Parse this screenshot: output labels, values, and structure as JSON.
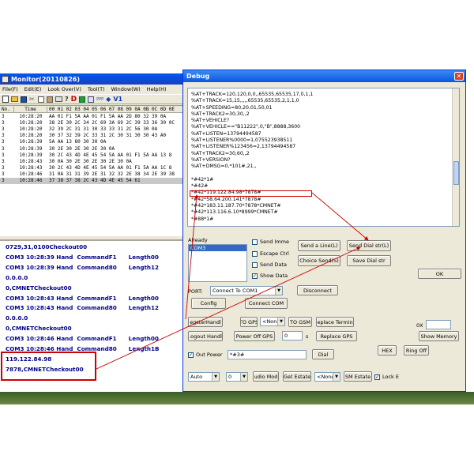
{
  "monitor": {
    "title": "Monitor(20110826)",
    "menu": [
      "File(F)",
      "Edit(E)",
      "Look Over(V)",
      "Tool(T)",
      "Window(W)",
      "Help(H)"
    ],
    "toolbar_v1": "V1",
    "headers": [
      "No.",
      "Time",
      "00 01 02 03 04 05 06 07 08 09 0A 0B 0C 0D 0E"
    ],
    "rows": [
      {
        "no": "3",
        "time": "10:28:20",
        "hex": "AA 01 F1 5A AA 01 F1 5A AA 2D 80 32 39 0A"
      },
      {
        "no": "3",
        "time": "10:28:20",
        "hex": "38 2E 30 2C 34 2C 69 3A 69 2C 39 33 36 30 0C"
      },
      {
        "no": "3",
        "time": "10:28:20",
        "hex": "32 39 2C 31 31 30 33 33 31 2C 56 30 0A"
      },
      {
        "no": "3",
        "time": "10:28:20",
        "hex": "30 37 32 39 2C 33 31 2C 30 31 30 30 43 A0"
      },
      {
        "no": "3",
        "time": "10:28:39",
        "hex": "5A AA 13 80 30 30 0A"
      },
      {
        "no": "3",
        "time": "10:28:39",
        "hex": "30 2E 30 2E 30 2E 30 0A"
      },
      {
        "no": "3",
        "time": "10:28:39",
        "hex": "30 2C 43 4D 4E 45 54 5A AA 01 F1 5A AA 13 8"
      },
      {
        "no": "3",
        "time": "10:28:43",
        "hex": "30 0A 30 2E 30 2E 30 2E 30 0A"
      },
      {
        "no": "3",
        "time": "10:28:43",
        "hex": "30 2C 43 4D 4E 45 54 5A AA 01 F1 5A AA 1C 8"
      },
      {
        "no": "3",
        "time": "10:28:46",
        "hex": "31 0A 31 31 39 2E 31 32 32 2E 38 34 2E 39 38"
      },
      {
        "no": "3",
        "time": "10:28:46",
        "hex": "37 38 37 38 2C 43 4D 4E 45 54 61"
      }
    ],
    "log_lines": [
      "0729,31,0100Checkout00",
      "COM3 10:28:39 Hand  CommandF1      Length00",
      "COM3 10:28:39 Hand  Command80      Length12",
      "0.0.0.0",
      "0,CMNETCheckout00",
      "COM3 10:28:43 Hand  CommandF1      Length00",
      "COM3 10:28:43 Hand  Command80      Length12",
      "0.0.0.0",
      "0,CMNETCheckout00",
      "COM3 10:28:46 Hand  CommandF1      Length00",
      "COM3 10:28:46 Hand  Command80      Length1B",
      "119.122.84.98",
      "7878,CMNETCheckout00"
    ]
  },
  "debug": {
    "title": "Debug",
    "text_lines": [
      "%AT+TRACK=120,120,0,0,,65535,65535,17,0,1,1",
      "%AT+TRACK=15,15,,,,,65535,65535,2,1,1,0",
      "%AT+SPEEDING=80,20,01,50,01",
      "%AT+TRACK2=30,30,,2",
      "%AT+VEHICLE?",
      "%AT+VEHICLE==\"B11222\",0,\"B\",8888,3600",
      "%AT+LISTEN=13794494587",
      "%AT+LISTENER%0000=1,075523938511",
      "%AT+LISTENER%123456=2,13794494587",
      "%AT+TRACK2=30,60,,2",
      "%AT+VERSION?",
      "%AT+DMSG=0,*101#,21,,",
      "",
      "*#42*1#",
      "*#42#",
      "*#42*119.122.84.98*7878#",
      "*#42*58.64.200.141*7878#",
      "*#42*183.11.187.70*7878*CMNET#",
      "*#42*113.116.6.10*8999*CMNET#",
      "*#88*1#"
    ],
    "already_label": "Already",
    "already_items": [
      "COM3"
    ],
    "checks": {
      "send_immediately": "Send Imme",
      "escape_ctrl": "Escape Ctrl",
      "send_data": "Send Data",
      "show_data": "Show Data"
    },
    "buttons": {
      "send_line": "Send a Line(L)",
      "send_dial": "Send Dial str(L)",
      "choice_send": "Choice Send(S)",
      "save_dial": "Save Dial str",
      "ok": "OK",
      "disconnect": "Disconnect",
      "config": "Config",
      "connect_com": "Connect COM",
      "register": "egsterHandl",
      "to_gps": "TO GPS",
      "to_gsm": "TO GSM",
      "replace_terminal": "eplace Termin",
      "logout": ".ogout Handl",
      "power_off_gps": "Power Off GPS",
      "replace_gps": "Replace GPS",
      "show_memory": "Show Memory",
      "dial": "Dial",
      "hex": "HEX",
      "ring_off": "Ring Off",
      "audio_mode": "udio Mod",
      "get_estate": "Get Estate",
      "gsm_estate": "SM Estate"
    },
    "port_label": "PORT:",
    "port_value": "Connect To COM1",
    "none_value": "<None>",
    "seconds_value": "0",
    "seconds_unit": "s",
    "ox_label": "0X",
    "out_power_label": "Out Power",
    "dial_value": "*#3#",
    "auto_value": "Auto",
    "zero_value": "0",
    "none_value2": "<None>",
    "lock_label": "Lock E"
  },
  "colors": {
    "xp_blue": "#0a246a",
    "dialog_face": "#ece9d8",
    "highlight_red": "#cc0000",
    "log_text": "#000088"
  }
}
